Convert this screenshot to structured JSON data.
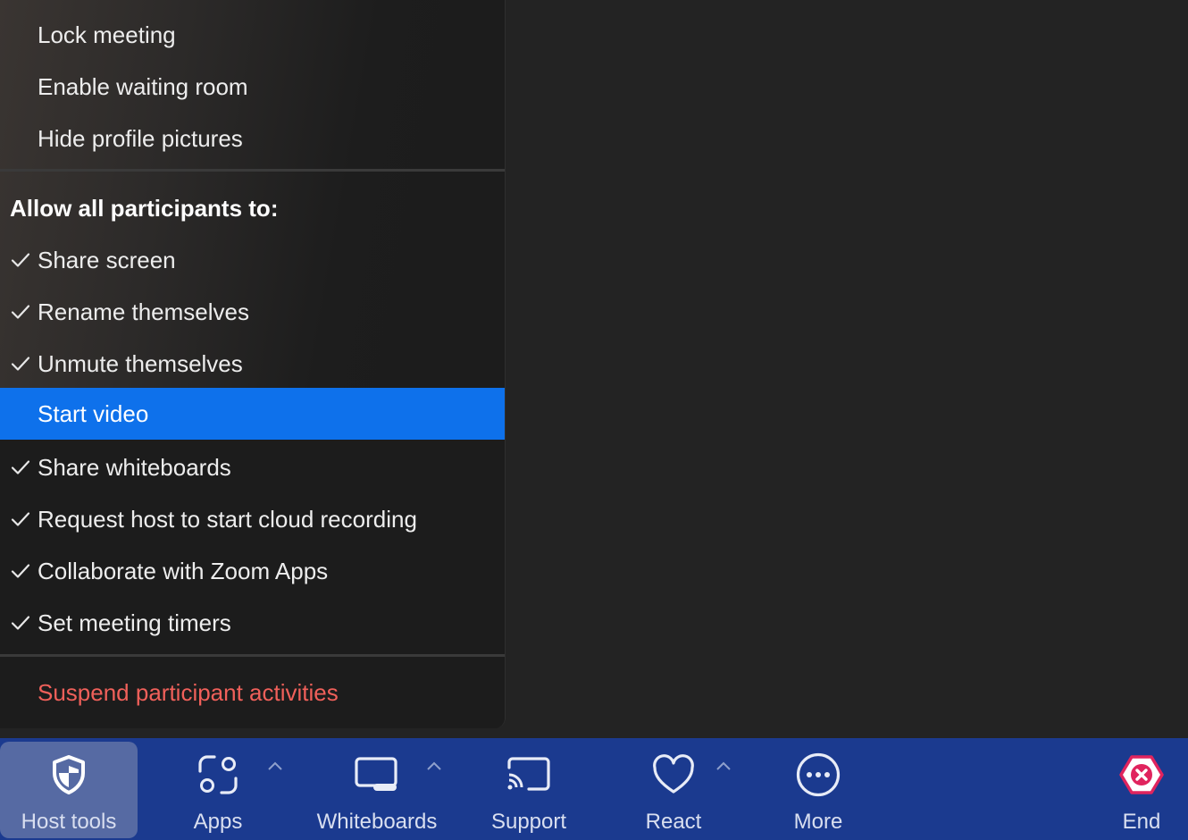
{
  "menu": {
    "top_items": [
      {
        "label": "Lock meeting"
      },
      {
        "label": "Enable waiting room"
      },
      {
        "label": "Hide profile pictures"
      }
    ],
    "section_title": "Allow all participants to:",
    "permissions": [
      {
        "label": "Share screen",
        "checked": true
      },
      {
        "label": "Rename themselves",
        "checked": true
      },
      {
        "label": "Unmute themselves",
        "checked": true
      },
      {
        "label": "Start video",
        "checked": false,
        "highlighted": true
      },
      {
        "label": "Share whiteboards",
        "checked": true
      },
      {
        "label": "Request host to start cloud recording",
        "checked": true
      },
      {
        "label": "Collaborate with Zoom Apps",
        "checked": true
      },
      {
        "label": "Set meeting timers",
        "checked": true
      }
    ],
    "suspend_label": "Suspend participant activities"
  },
  "toolbar": {
    "host_tools": "Host tools",
    "apps": "Apps",
    "whiteboards": "Whiteboards",
    "support": "Support",
    "react": "React",
    "more": "More",
    "end": "End"
  },
  "colors": {
    "highlight": "#0e71eb",
    "toolbar_bg": "#1b3a8f",
    "danger": "#f0605a",
    "end_accent": "#e0245e"
  }
}
